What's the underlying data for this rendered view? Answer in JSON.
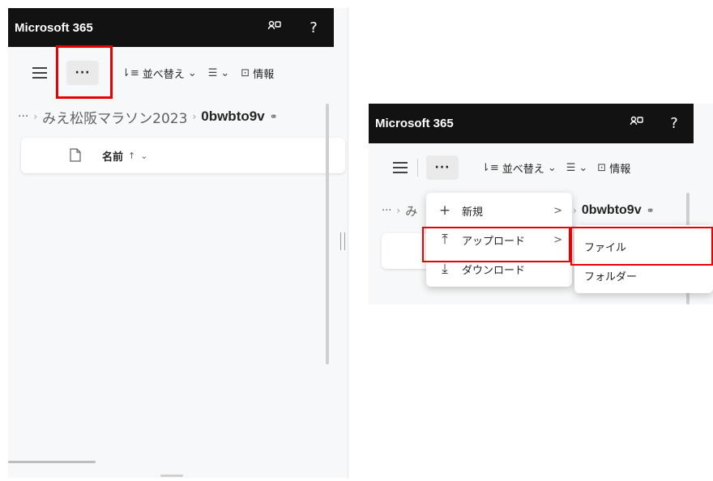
{
  "left": {
    "app_title": "Microsoft 365",
    "more_label": "···",
    "sort_label": "並べ替え",
    "info_label": "情報",
    "breadcrumb": {
      "ellipsis": "···",
      "folder": "みえ松阪マラソン2023",
      "current": "0bwbto9v"
    },
    "column_name": "名前",
    "sort_arrow": "↑"
  },
  "right": {
    "app_title": "Microsoft 365",
    "more_label": "···",
    "sort_label": "並べ替え",
    "info_label": "情報",
    "breadcrumb": {
      "ellipsis": "···",
      "folder_partial": "み",
      "current": "0bwbto9v"
    },
    "menu": [
      {
        "icon": "plus-icon",
        "label": "新規"
      },
      {
        "icon": "upload-icon",
        "label": "アップロード"
      },
      {
        "icon": "download-icon",
        "label": "ダウンロード"
      }
    ],
    "submenu": [
      {
        "label": "ファイル"
      },
      {
        "label": "フォルダー"
      }
    ]
  },
  "colors": {
    "header_bg": "#121212",
    "highlight": "#e60000",
    "panel_bg": "#f7f8f9"
  }
}
